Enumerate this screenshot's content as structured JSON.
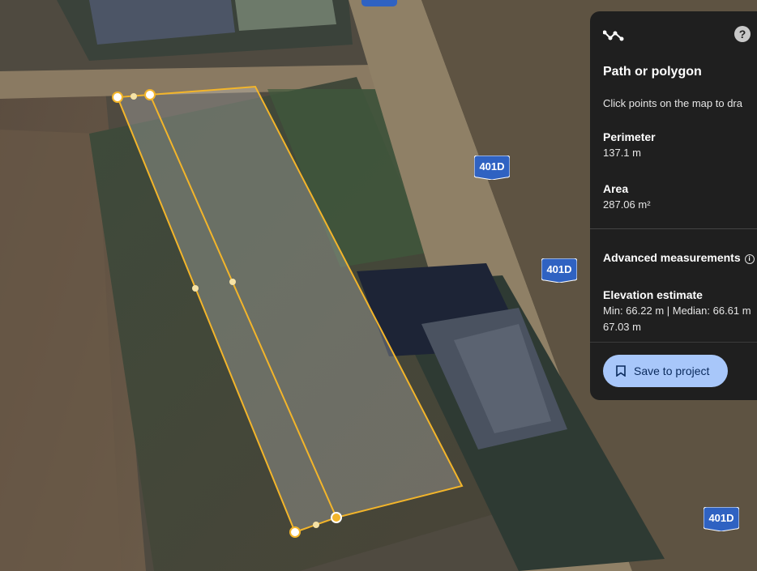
{
  "map": {
    "road_badges": [
      {
        "label": "401D"
      },
      {
        "label": "401D"
      },
      {
        "label": "401D"
      }
    ]
  },
  "panel": {
    "tool_icon": "path-measure-icon",
    "help_icon": "help-icon",
    "help_glyph": "?",
    "title": "Path or polygon",
    "instruction": "Click points on the map to dra",
    "perimeter_label": "Perimeter",
    "perimeter_value": "137.1 m",
    "area_label": "Area",
    "area_value": "287.06 m²",
    "advanced_label": "Advanced measurements",
    "info_glyph": "i",
    "elevation_label": "Elevation estimate",
    "elevation_line1": "Min: 66.22 m | Median: 66.61 m",
    "elevation_line2": "67.03 m",
    "save_label": "Save to project",
    "save_icon": "bookmark-icon"
  },
  "colors": {
    "polygon_stroke": "#f3b52a",
    "panel_bg": "#1f1f1f",
    "button_bg": "#a8c7fa",
    "badge_bg": "#2f62c2"
  }
}
